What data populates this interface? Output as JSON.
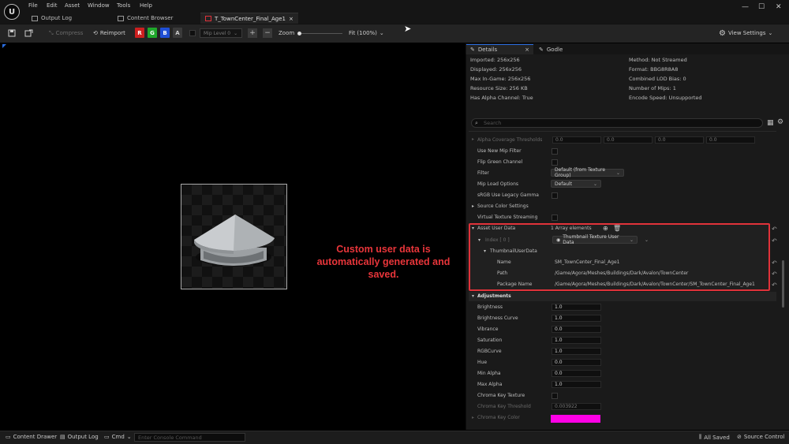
{
  "window": {
    "menu": [
      "File",
      "Edit",
      "Asset",
      "Window",
      "Tools",
      "Help"
    ],
    "tabs": [
      {
        "label": "Output Log",
        "icon": "log-icon"
      },
      {
        "label": "Content Browser",
        "icon": "folder-icon"
      },
      {
        "label": "T_TownCenter_Final_Age1",
        "icon": "texture-icon",
        "active": true
      }
    ],
    "controls": {
      "minimize": "—",
      "maximize": "☐",
      "close": "✕"
    }
  },
  "toolbar": {
    "compress_label": "Compress",
    "reimport_label": "Reimport",
    "channels": [
      {
        "label": "R",
        "color": "#cc1f1f"
      },
      {
        "label": "G",
        "color": "#1fa82b"
      },
      {
        "label": "B",
        "color": "#1f4fd6"
      },
      {
        "label": "A",
        "color": "#3a3a3a"
      }
    ],
    "mip_label": "Mip Level 0",
    "zoom_label": "Zoom",
    "fit_label": "Fit (100%)",
    "view_settings_label": "View Settings"
  },
  "viewport": {
    "callout": "Custom user data is automatically generated and saved."
  },
  "details": {
    "tabs": [
      "Details",
      "Godle"
    ],
    "info_left": [
      "Imported: 256x256",
      "Displayed: 256x256",
      "Max In-Game: 256x256",
      "Resource Size: 256 KB",
      "Has Alpha Channel: True"
    ],
    "info_right": [
      "Method: Not Streamed",
      "Format: BBG8R8A8",
      "Combined LOD Bias: 0",
      "Number of Mips: 1",
      "Encode Speed: Unsupported"
    ],
    "search_placeholder": "Search",
    "alpha_coverage": {
      "label": "Alpha Coverage Thresholds",
      "values": [
        "0.0",
        "0.0",
        "0.0",
        "0.0"
      ]
    },
    "use_new_mip_filter": "Use New Mip Filter",
    "flip_green": "Flip Green Channel",
    "filter": {
      "label": "Filter",
      "value": "Default (from Texture Group)"
    },
    "mip_load": {
      "label": "Mip Load Options",
      "value": "Default"
    },
    "srgb_legacy": "sRGB Use Legacy Gamma",
    "source_color": "Source Color Settings",
    "virtual_streaming": "Virtual Texture Streaming",
    "asset_user_data": {
      "label": "Asset User Data",
      "count": "1 Array elements",
      "index_label": "Index [ 0 ]",
      "index_value": "Thumbnail Texture User Data",
      "struct_label": "ThumbnailUserData",
      "name_label": "Name",
      "name_value": "SM_TownCenter_Final_Age1",
      "path_label": "Path",
      "path_value": "/Game/Agora/Meshes/Buildings/Dark/Avalon/TownCenter",
      "package_label": "Package Name",
      "package_value": "/Game/Agora/Meshes/Buildings/Dark/Avalon/TownCenter/SM_TownCenter_Final_Age1"
    },
    "adjustments": {
      "label": "Adjustments",
      "rows": [
        {
          "label": "Brightness",
          "value": "1.0"
        },
        {
          "label": "Brightness Curve",
          "value": "1.0"
        },
        {
          "label": "Vibrance",
          "value": "0.0"
        },
        {
          "label": "Saturation",
          "value": "1.0"
        },
        {
          "label": "RGBCurve",
          "value": "1.0"
        },
        {
          "label": "Hue",
          "value": "0.0"
        },
        {
          "label": "Min Alpha",
          "value": "0.0"
        },
        {
          "label": "Max Alpha",
          "value": "1.0"
        }
      ],
      "chroma_key_texture": "Chroma Key Texture",
      "chroma_key_threshold": {
        "label": "Chroma Key Threshold",
        "value": "0.003922"
      },
      "chroma_key_color": {
        "label": "Chroma Key Color",
        "color": "#ff00e6"
      }
    }
  },
  "statusbar": {
    "content_drawer": "Content Drawer",
    "output_log": "Output Log",
    "cmd": "Cmd",
    "console_placeholder": "Enter Console Command",
    "all_saved": "All Saved",
    "source_control": "Source Control"
  }
}
